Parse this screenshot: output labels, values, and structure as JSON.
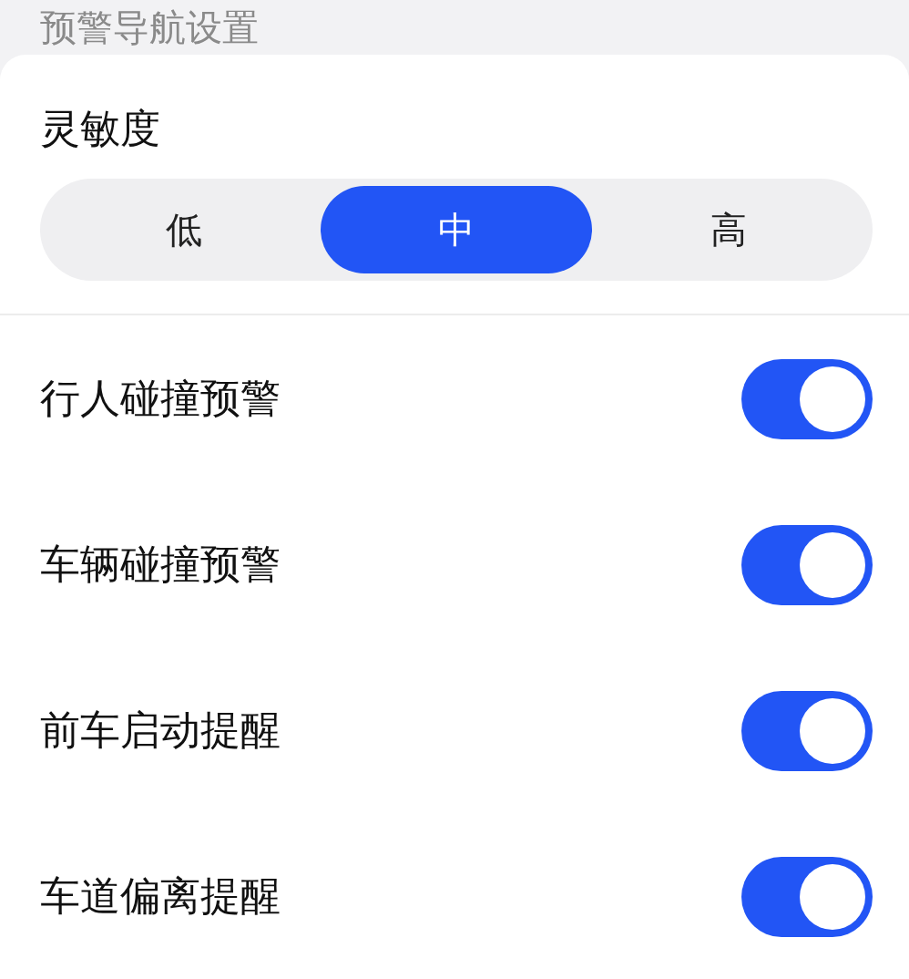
{
  "section_title": "预警导航设置",
  "sensitivity": {
    "label": "灵敏度",
    "options": [
      {
        "label": "低",
        "selected": false
      },
      {
        "label": "中",
        "selected": true
      },
      {
        "label": "高",
        "selected": false
      }
    ]
  },
  "settings": [
    {
      "label": "行人碰撞预警",
      "on": true
    },
    {
      "label": "车辆碰撞预警",
      "on": true
    },
    {
      "label": "前车启动提醒",
      "on": true
    },
    {
      "label": "车道偏离提醒",
      "on": true
    }
  ]
}
